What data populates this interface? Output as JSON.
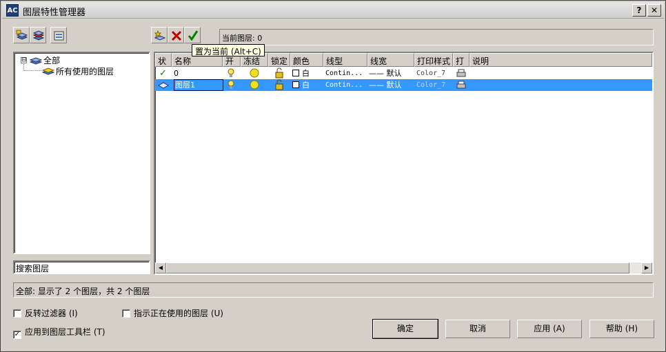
{
  "window": {
    "title": "图层特性管理器",
    "app_icon_text": "AC",
    "help_button": "?",
    "close_button": "✕"
  },
  "toolbar": {
    "current_layer_label": "当前图层: 0",
    "tooltip": "置为当前 (Alt+C)"
  },
  "tree": {
    "root_label": "全部",
    "child_label": "所有使用的图层",
    "expander": "⊟"
  },
  "search": {
    "value": "搜索图层"
  },
  "grid": {
    "columns": [
      "状",
      "名称",
      "开",
      "冻结",
      "锁定",
      "颜色",
      "线型",
      "线宽",
      "打印样式",
      "打",
      "说明"
    ],
    "rows": [
      {
        "status": "✓",
        "name": "0",
        "color": "白",
        "linetype": "Contin...",
        "lineweight": "—— 默认",
        "plotstyle": "Color_7"
      },
      {
        "status": "◇",
        "name": "图层1",
        "color": "白",
        "linetype": "Contin...",
        "lineweight": "—— 默认",
        "plotstyle": "Color_7"
      }
    ]
  },
  "status_text": "全部: 显示了 2 个图层，共 2 个图层",
  "options": {
    "invert_filter": "反转过滤器 (I)",
    "indicate_in_use": "指示正在使用的图层 (U)",
    "apply_to_toolbar": "应用到图层工具栏 (T)",
    "apply_to_toolbar_checked": "✓"
  },
  "buttons": {
    "ok": "确定",
    "cancel": "取消",
    "apply": "应用 (A)",
    "help": "帮助 (H)"
  },
  "colors": {
    "selection": "#3399ff",
    "dialog_bg": "#d4d0c8",
    "tooltip_bg": "#ffffe1"
  }
}
